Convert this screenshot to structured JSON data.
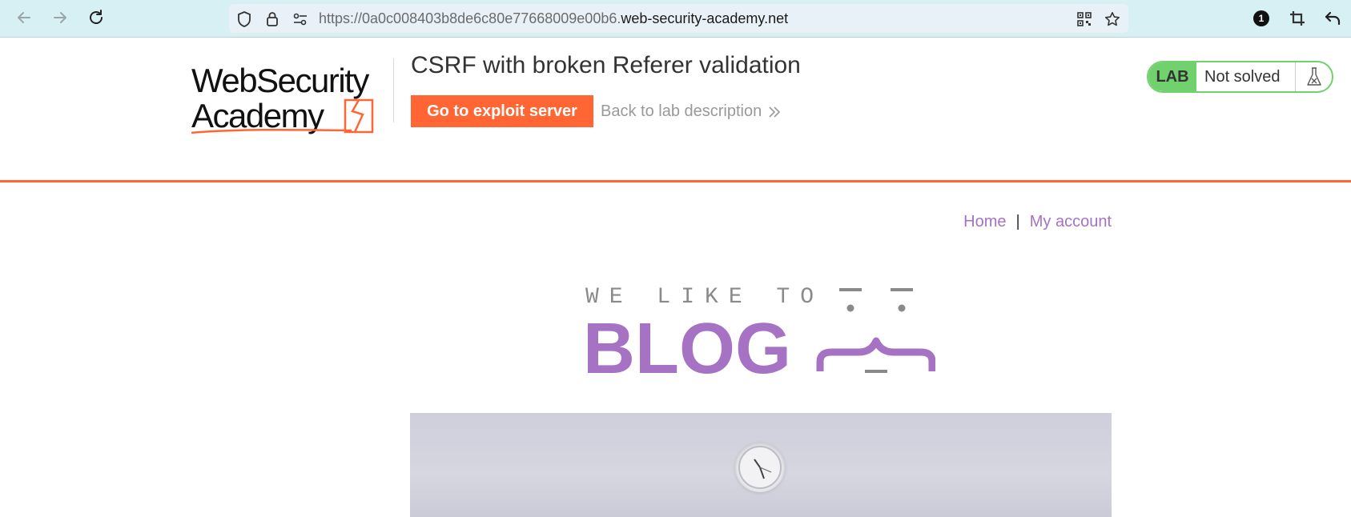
{
  "browser": {
    "url_prefix": "https://0a0c008403b8de6c80e77668009e00b6.",
    "url_domain": "web-security-academy.net",
    "extension_badge": "1"
  },
  "lab": {
    "logo_line1": "WebSecurity",
    "logo_line2": "Academy",
    "title": "CSRF with broken Referer validation",
    "exploit_button": "Go to exploit server",
    "back_link": "Back to lab description",
    "status_badge": "LAB",
    "status_text": "Not solved",
    "accent_color": "#ff6633",
    "solved_green": "#70d16d"
  },
  "blog": {
    "nav": {
      "home": "Home",
      "separator": "|",
      "my_account": "My account"
    },
    "banner_top": "WE LIKE TO",
    "banner_main": "BLOG",
    "accent_color": "#a672c4"
  }
}
